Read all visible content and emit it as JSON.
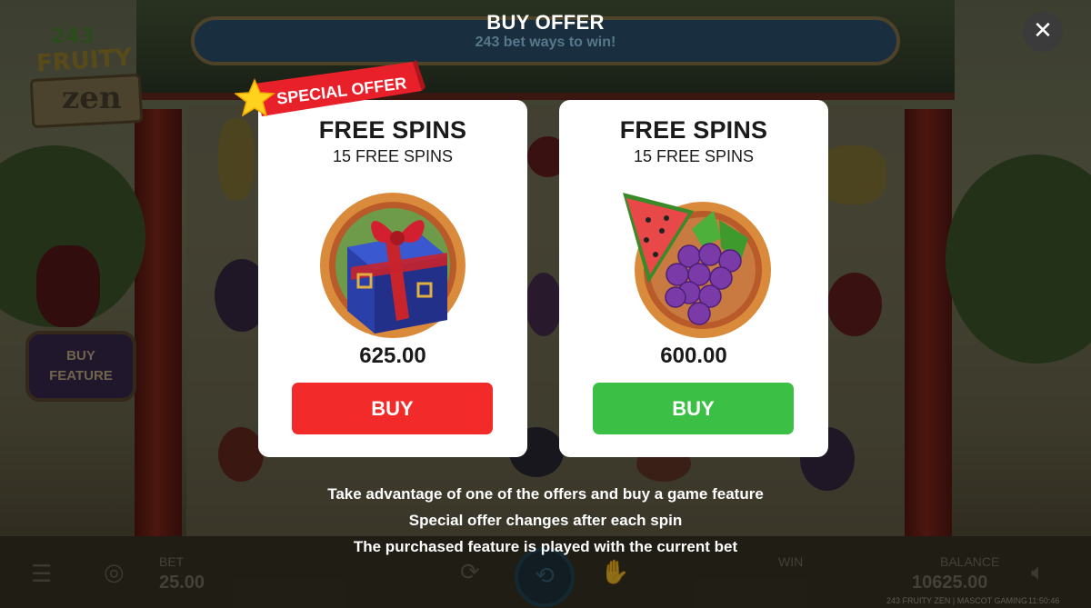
{
  "header": {
    "title": "BUY OFFER",
    "subtitle": "243 bet ways to win!"
  },
  "logo": {
    "line1": "243",
    "line2": "FRUITY",
    "line3": "zen"
  },
  "side_button": {
    "line1": "BUY",
    "line2": "FEATURE"
  },
  "ribbon": {
    "label": "SPECIAL OFFER"
  },
  "offers": [
    {
      "title": "FREE SPINS",
      "subtitle": "15 FREE SPINS",
      "price": "625.00",
      "buy_label": "BUY",
      "icon": "gift-box-icon",
      "button_color": "#f22a2a"
    },
    {
      "title": "FREE SPINS",
      "subtitle": "15 FREE SPINS",
      "price": "600.00",
      "buy_label": "BUY",
      "icon": "watermelon-grapes-icon",
      "button_color": "#3cbf45"
    }
  ],
  "info_lines": [
    "Take advantage of one of the offers and buy a game feature",
    "Special offer changes after each spin",
    "The purchased feature is played with the current bet"
  ],
  "bottom_bar": {
    "bet_label": "BET",
    "bet_value": "25.00",
    "win_label": "WIN",
    "balance_label": "BALANCE",
    "balance_value": "10625.00"
  },
  "footer": {
    "game": "243 FRUITY ZEN | MASCOT GAMING",
    "time": "11:50:46"
  },
  "colors": {
    "buy_red": "#f22a2a",
    "buy_green": "#3cbf45",
    "ribbon_red": "#e8202a",
    "star": "#ffd21e"
  }
}
